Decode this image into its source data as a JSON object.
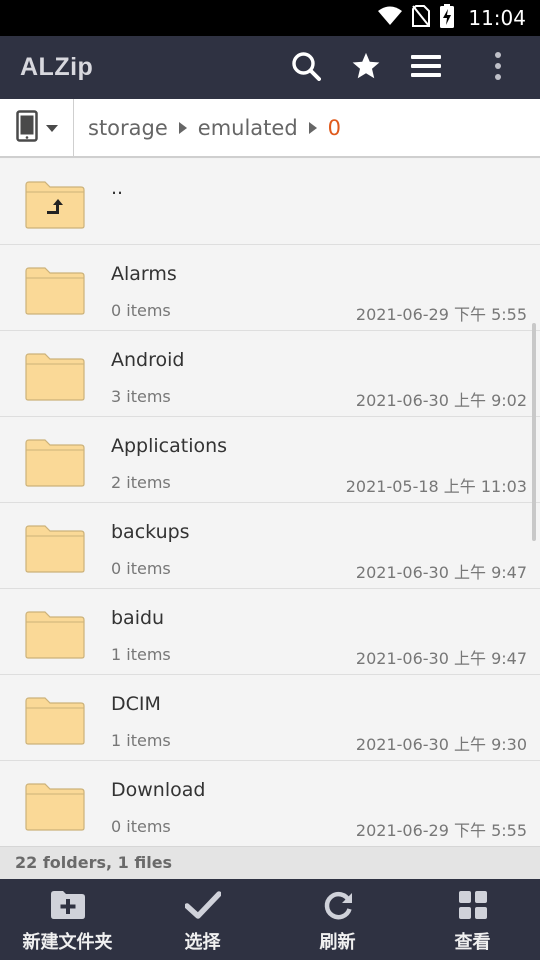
{
  "status_bar": {
    "time": "11:04",
    "icons": [
      "wifi-icon",
      "no-sim-icon",
      "battery-charging-icon"
    ]
  },
  "app_bar": {
    "title": "ALZip",
    "actions": [
      "search-icon",
      "star-icon",
      "menu-icon",
      "more-vert-icon"
    ]
  },
  "path_bar": {
    "device_icon": "phone-icon",
    "crumbs": [
      "storage",
      "emulated",
      "0"
    ]
  },
  "files": [
    {
      "name": "..",
      "icon": "folder-up-icon"
    },
    {
      "name": "Alarms",
      "count": "0 items",
      "date": "2021-06-29 下午 5:55",
      "icon": "folder-icon"
    },
    {
      "name": "Android",
      "count": "3 items",
      "date": "2021-06-30 上午 9:02",
      "icon": "folder-icon"
    },
    {
      "name": "Applications",
      "count": "2 items",
      "date": "2021-05-18 上午 11:03",
      "icon": "folder-icon"
    },
    {
      "name": "backups",
      "count": "0 items",
      "date": "2021-06-30 上午 9:47",
      "icon": "folder-icon"
    },
    {
      "name": "baidu",
      "count": "1 items",
      "date": "2021-06-30 上午 9:47",
      "icon": "folder-icon"
    },
    {
      "name": "DCIM",
      "count": "1 items",
      "date": "2021-06-30 上午 9:30",
      "icon": "folder-icon"
    },
    {
      "name": "Download",
      "count": "0 items",
      "date": "2021-06-29 下午 5:55",
      "icon": "folder-icon"
    }
  ],
  "summary": "22 folders, 1 files",
  "bottom_bar": [
    {
      "label": "新建文件夹",
      "icon": "new-folder-icon"
    },
    {
      "label": "选择",
      "icon": "check-icon"
    },
    {
      "label": "刷新",
      "icon": "refresh-icon"
    },
    {
      "label": "查看",
      "icon": "grid-view-icon"
    }
  ],
  "colors": {
    "app_bar": "#2f3242",
    "accent": "#e05a1c",
    "folder": "#fad997",
    "list_bg": "#f4f4f4"
  }
}
